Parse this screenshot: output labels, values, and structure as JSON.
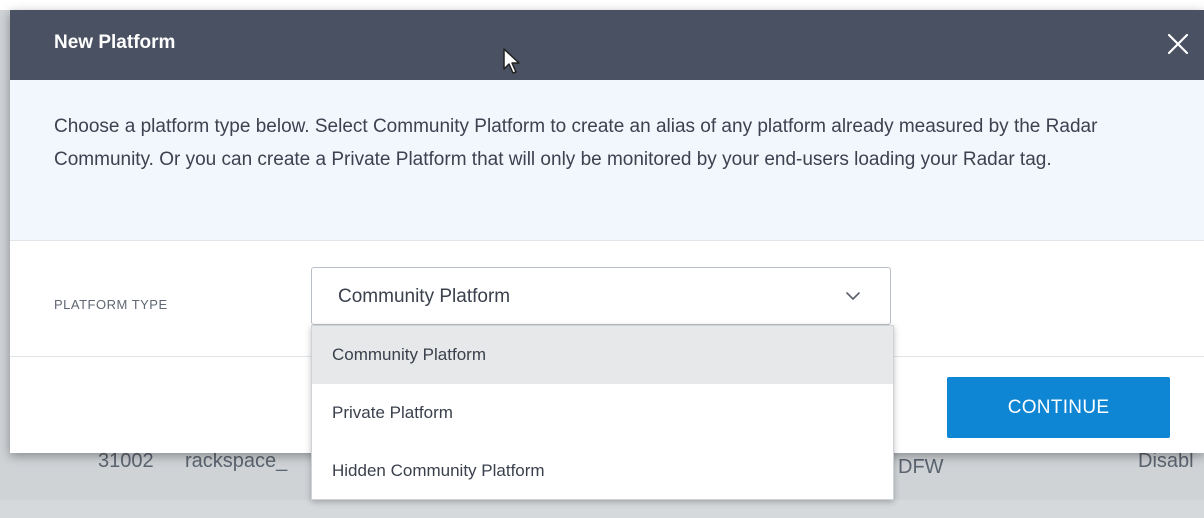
{
  "modal": {
    "title": "New Platform",
    "description": "Choose a platform type below. Select Community Platform to create an alias of any platform already measured by the Radar Community. Or you can create a Private Platform that will only be monitored by your end-users loading your Radar tag.",
    "close_icon": "close-icon"
  },
  "form": {
    "platform_type_label": "PLATFORM TYPE",
    "selected_value": "Community Platform",
    "options": [
      "Community Platform",
      "Private Platform",
      "Hidden Community Platform"
    ]
  },
  "footer": {
    "continue_label": "CONTINUE"
  },
  "background_row": {
    "id": "31002",
    "name": "rackspace_",
    "location": "DFW",
    "status": "Disabl"
  },
  "colors": {
    "header_bg": "#4a5162",
    "accent": "#0e86d4",
    "description_bg": "#f1f7fc",
    "selected_option_bg": "#e6e8e9"
  }
}
